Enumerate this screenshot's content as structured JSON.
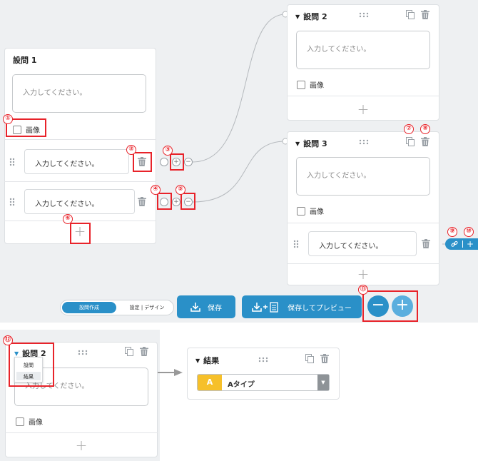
{
  "placeholder": "入力してください。",
  "image_label": "画像",
  "q1": {
    "title": "設問 1"
  },
  "q2": {
    "title": "設問 2"
  },
  "q3": {
    "title": "設問 3"
  },
  "toolbar": {
    "tab_active": "設問作成",
    "tab_other": "設定 | デザイン",
    "save": "保存",
    "save_preview": "保存してプレビュー"
  },
  "dropdown": {
    "items": [
      "設問",
      "結果"
    ]
  },
  "result": {
    "title": "結果",
    "badge": "A",
    "value": "Aタイプ"
  },
  "callouts": [
    "①",
    "②",
    "③",
    "④",
    "⑤",
    "⑥",
    "⑦",
    "⑧",
    "⑨",
    "⑩",
    "⑪",
    "⑫"
  ],
  "colors": {
    "accent": "#2a90c8",
    "highlight": "#e8232a",
    "badge": "#f6c02a"
  },
  "icons": [
    "trash-icon",
    "copy-icon",
    "drag-dots-icon",
    "drag-handle-icon",
    "plus-icon",
    "minus-icon",
    "link-icon",
    "download-icon",
    "document-icon",
    "chevron-down-icon"
  ]
}
